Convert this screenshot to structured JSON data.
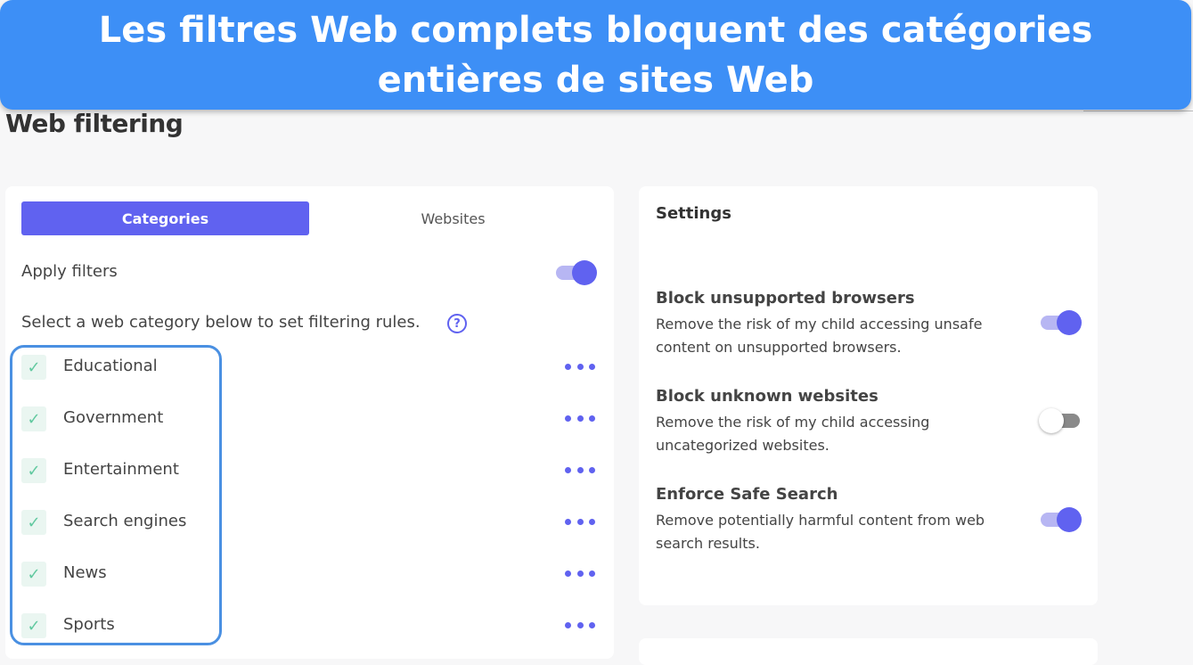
{
  "banner": {
    "text": "Les filtres Web complets bloquent des catégories entières de sites Web"
  },
  "page": {
    "title": "Web filtering"
  },
  "tabs": [
    {
      "label": "Categories",
      "active": true
    },
    {
      "label": "Websites",
      "active": false
    }
  ],
  "filters": {
    "apply_label": "Apply filters",
    "apply_enabled": true,
    "select_hint": "Select a web category below to set filtering rules.",
    "help_icon": "question-circle-icon",
    "categories": [
      {
        "label": "Educational",
        "checked": true
      },
      {
        "label": "Government",
        "checked": true
      },
      {
        "label": "Entertainment",
        "checked": true
      },
      {
        "label": "Search engines",
        "checked": true
      },
      {
        "label": "News",
        "checked": true
      },
      {
        "label": "Sports",
        "checked": true
      }
    ]
  },
  "settings": {
    "title": "Settings",
    "items": [
      {
        "title": "Block unsupported browsers",
        "description": "Remove the risk of my child accessing unsafe content on unsupported browsers.",
        "enabled": true
      },
      {
        "title": "Block unknown websites",
        "description": "Remove the risk of my child accessing uncategorized websites.",
        "enabled": false
      },
      {
        "title": "Enforce Safe Search",
        "description": "Remove potentially harmful content from web search results.",
        "enabled": true
      }
    ]
  },
  "colors": {
    "banner": "#3d8ff6",
    "accent": "#6062f0",
    "check": "#62c9a0",
    "highlight": "#4a90e2"
  }
}
